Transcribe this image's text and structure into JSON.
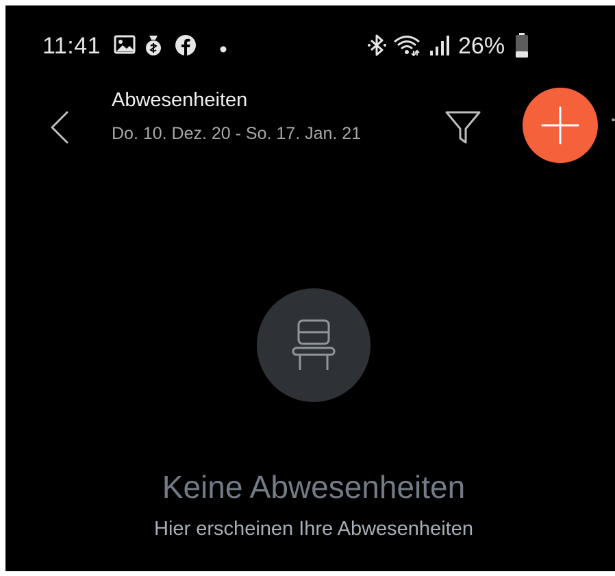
{
  "status_bar": {
    "time": "11:41",
    "battery_percent": "26%",
    "icons": [
      "image-icon",
      "money-bag-icon",
      "facebook-icon",
      "dot-icon",
      "bluetooth-icon",
      "wifi-icon",
      "signal-icon",
      "battery-icon"
    ],
    "battery_level": 0.26
  },
  "header": {
    "title": "Abwesenheiten",
    "subtitle": "Do. 10. Dez. 20 - So. 17. Jan. 21",
    "back_icon": "chevron-left-icon",
    "filter_icon": "filter-icon",
    "add_icon": "plus-icon"
  },
  "empty_state": {
    "icon": "chair-icon",
    "title": "Keine Abwesenheiten",
    "subtitle": "Hier erscheinen Ihre Abwesenheiten"
  },
  "colors": {
    "background": "#000000",
    "accent": "#f4613a",
    "empty_circle": "#2e3237",
    "empty_title": "#737c86",
    "subtitle_text": "#a9a9a9"
  }
}
